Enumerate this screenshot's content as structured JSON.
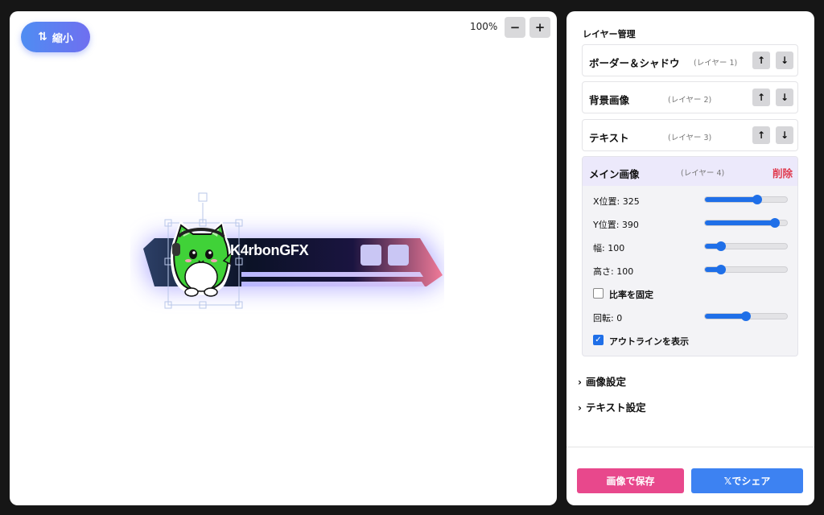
{
  "canvas": {
    "shrink_icon": "swap-vertical-icon",
    "shrink_label": "縮小",
    "zoom_level": "100%",
    "zoom_out_label": "−",
    "zoom_in_label": "+",
    "banner_name": "K4rbonGFX"
  },
  "layers_panel": {
    "title": "レイヤー管理",
    "up_label": "↑",
    "down_label": "↓",
    "layers": [
      {
        "name": "ボーダー＆シャドウ",
        "num": "(レイヤー 1)"
      },
      {
        "name": "背景画像",
        "num": "(レイヤー 2)"
      },
      {
        "name": "テキスト",
        "num": "(レイヤー 3)"
      }
    ],
    "active": {
      "name": "メイン画像",
      "num": "(レイヤー 4)",
      "delete_label": "削除",
      "props": [
        {
          "label": "X位置: 325",
          "fraction": 0.64
        },
        {
          "label": "Y位置: 390",
          "fraction": 0.85
        },
        {
          "label": "幅: 100",
          "fraction": 0.2
        },
        {
          "label": "高さ: 100",
          "fraction": 0.2
        }
      ],
      "lock_ratio": {
        "label": "比率を固定",
        "checked": false
      },
      "rotation": {
        "label": "回転: 0",
        "fraction": 0.5
      },
      "outline": {
        "label": "アウトラインを表示",
        "checked": true
      }
    },
    "sections": [
      "画像設定",
      "テキスト設定"
    ]
  },
  "footer": {
    "save_label": "画像で保存",
    "share_label": "𝕏でシェア"
  },
  "colors": {
    "accent": "#1f6fe8",
    "delete": "#e03a4e",
    "save": "#e8488c",
    "share": "#3d82f2"
  }
}
